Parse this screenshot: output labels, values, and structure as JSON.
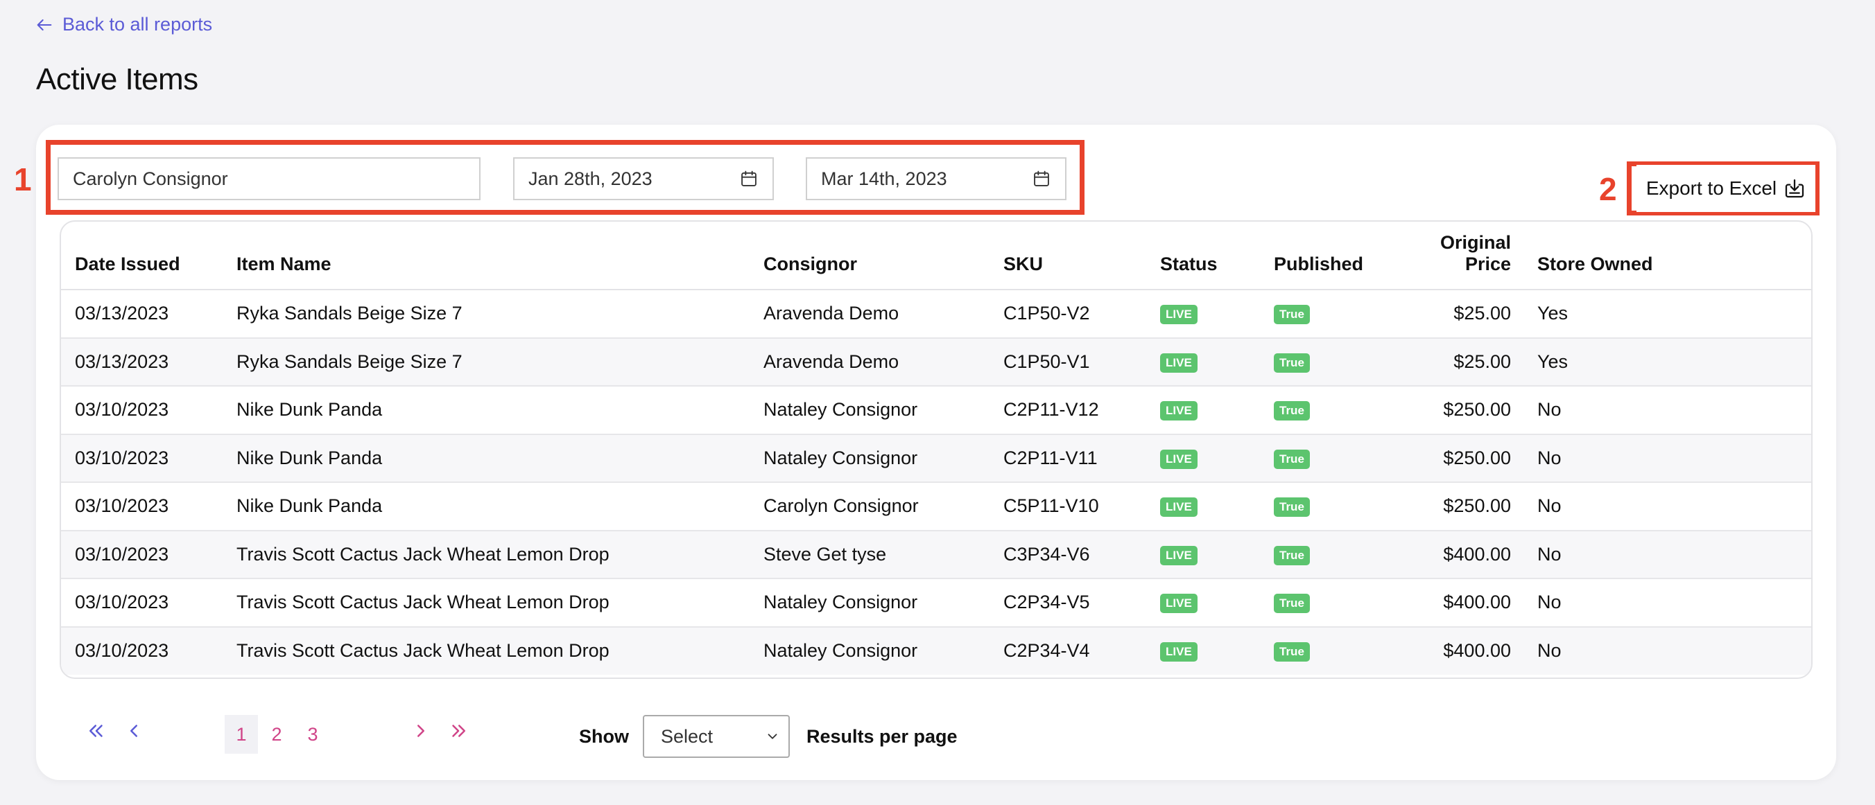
{
  "back_link": {
    "label": "Back to all reports"
  },
  "page_title": "Active Items",
  "filters": {
    "consignor_value": "Carolyn Consignor",
    "start_date": "Jan 28th, 2023",
    "end_date": "Mar 14th, 2023"
  },
  "annotations": {
    "filters_number": "1",
    "export_number": "2"
  },
  "export_button": {
    "label": "Export to Excel"
  },
  "table": {
    "headers": [
      "Date Issued",
      "Item Name",
      "Consignor",
      "SKU",
      "Status",
      "Published",
      "Original Price",
      "Store Owned"
    ],
    "rows": [
      [
        "03/13/2023",
        "Ryka Sandals Beige Size 7",
        "Aravenda Demo",
        "C1P50-V2",
        "LIVE",
        "True",
        "$25.00",
        "Yes"
      ],
      [
        "03/13/2023",
        "Ryka Sandals Beige Size 7",
        "Aravenda Demo",
        "C1P50-V1",
        "LIVE",
        "True",
        "$25.00",
        "Yes"
      ],
      [
        "03/10/2023",
        "Nike Dunk Panda",
        "Nataley Consignor",
        "C2P11-V12",
        "LIVE",
        "True",
        "$250.00",
        "No"
      ],
      [
        "03/10/2023",
        "Nike Dunk Panda",
        "Nataley Consignor",
        "C2P11-V11",
        "LIVE",
        "True",
        "$250.00",
        "No"
      ],
      [
        "03/10/2023",
        "Nike Dunk Panda",
        "Carolyn Consignor",
        "C5P11-V10",
        "LIVE",
        "True",
        "$250.00",
        "No"
      ],
      [
        "03/10/2023",
        "Travis Scott Cactus Jack Wheat Lemon Drop",
        "Steve Get tyse",
        "C3P34-V6",
        "LIVE",
        "True",
        "$400.00",
        "No"
      ],
      [
        "03/10/2023",
        "Travis Scott Cactus Jack Wheat Lemon Drop",
        "Nataley Consignor",
        "C2P34-V5",
        "LIVE",
        "True",
        "$400.00",
        "No"
      ],
      [
        "03/10/2023",
        "Travis Scott Cactus Jack Wheat Lemon Drop",
        "Nataley Consignor",
        "C2P34-V4",
        "LIVE",
        "True",
        "$400.00",
        "No"
      ]
    ]
  },
  "pagination": {
    "pages": [
      "1",
      "2",
      "3"
    ],
    "current_page": "1",
    "show_label": "Show",
    "select_value": "Select",
    "results_label": "Results per page"
  },
  "colors": {
    "annotation_red": "#e8432c",
    "link_purple": "#5b5bd6",
    "page_pink": "#d04488",
    "badge_green": "#5cc46e"
  },
  "icons": {
    "back": "arrow-left-icon",
    "calendar": "calendar-icon",
    "export": "download-tray-icon",
    "first": "double-chevron-left-icon",
    "prev": "chevron-left-icon",
    "next": "chevron-right-icon",
    "last": "double-chevron-right-icon",
    "select": "chevron-down-icon"
  }
}
